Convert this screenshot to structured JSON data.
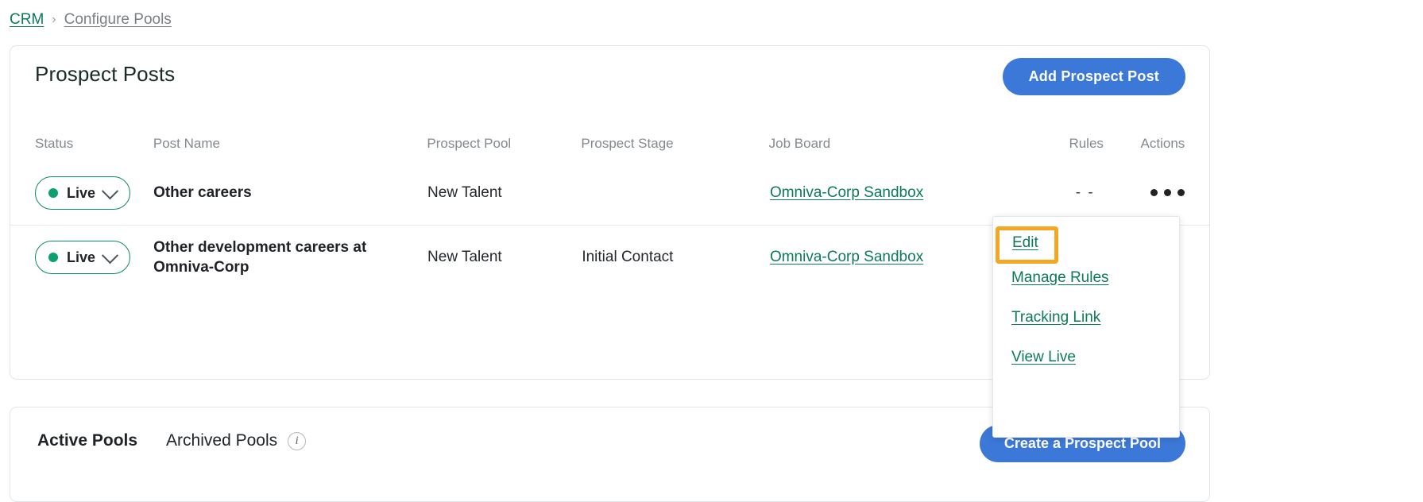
{
  "breadcrumb": {
    "root": "CRM",
    "separator": "›",
    "current": "Configure Pools"
  },
  "prospect_posts": {
    "title": "Prospect Posts",
    "add_button": "Add Prospect Post",
    "columns": {
      "status": "Status",
      "post_name": "Post Name",
      "prospect_pool": "Prospect Pool",
      "prospect_stage": "Prospect Stage",
      "job_board": "Job Board",
      "rules": "Rules",
      "actions": "Actions"
    },
    "rows": [
      {
        "status": "Live",
        "post_name": "Other careers",
        "prospect_pool": "New Talent",
        "prospect_stage": "",
        "job_board": "Omniva-Corp Sandbox",
        "rules": "- -"
      },
      {
        "status": "Live",
        "post_name": "Other development careers at Omniva-Corp",
        "prospect_pool": "New Talent",
        "prospect_stage": "Initial Contact",
        "job_board": "Omniva-Corp Sandbox",
        "rules": ""
      }
    ]
  },
  "actions_menu": {
    "items": [
      "Edit",
      "Manage Rules",
      "Tracking Link",
      "View Live"
    ],
    "focused_item": "Edit"
  },
  "pools_section": {
    "tabs": [
      {
        "label": "Active Pools",
        "active": true
      },
      {
        "label": "Archived Pools",
        "active": false
      }
    ],
    "info_icon_glyph": "i",
    "create_button": "Create a Prospect Pool"
  },
  "colors": {
    "brand_green": "#0b7a5b",
    "status_green": "#0ba06e",
    "primary_blue": "#3b78d8",
    "focus_orange": "#f5a623",
    "muted_text": "#84898f"
  }
}
